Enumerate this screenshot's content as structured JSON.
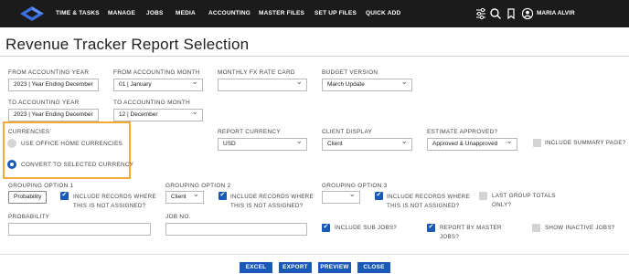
{
  "nav": {
    "items": [
      "TIME & TASKS",
      "MANAGE",
      "JOBS",
      "MEDIA",
      "ACCOUNTING",
      "MASTER FILES",
      "SET UP FILES",
      "QUICK ADD"
    ],
    "user": "MARIA ALVIR",
    "icons": [
      "sliders-icon",
      "search-icon",
      "bookmark-icon",
      "user-circle-icon"
    ],
    "colors": {
      "bar": "#1b1b1b",
      "logo": "#3b6fe0",
      "accent": "#1a59b8",
      "highlight": "#f0a93a"
    }
  },
  "page": {
    "title": "Revenue Tracker Report Selection"
  },
  "form": {
    "from_year": {
      "label": "FROM ACCOUNTING YEAR",
      "value": "2023 | Year Ending December"
    },
    "from_month": {
      "label": "FROM ACCOUNTING MONTH",
      "value": "01 | January"
    },
    "fx_rate_card": {
      "label": "MONTHLY FX RATE CARD",
      "value": ""
    },
    "budget_version": {
      "label": "BUDGET VERSION",
      "value": "March Update"
    },
    "to_year": {
      "label": "TO ACCOUNTING YEAR",
      "value": "2023 | Year Ending December"
    },
    "to_month": {
      "label": "TO ACCOUNTING MONTH",
      "value": "12 | December"
    },
    "currencies": {
      "label": "CURRENCIES",
      "option1": "USE OFFICE HOME CURRENCIES",
      "option2": "CONVERT TO SELECTED CURRENCY",
      "selected": "CONVERT TO SELECTED CURRENCY"
    },
    "report_currency": {
      "label": "REPORT CURRENCY",
      "value": "USD"
    },
    "client_display": {
      "label": "CLIENT DISPLAY",
      "value": "Client"
    },
    "estimate_approved": {
      "label": "ESTIMATE APPROVED?",
      "value": "Approved & Unapproved"
    },
    "include_summary": {
      "label": "INCLUDE SUMMARY PAGE?",
      "checked": false
    },
    "grouping1": {
      "label": "GROUPING OPTION 1",
      "value": "Probability",
      "include_label": "INCLUDE RECORDS WHERE THIS IS NOT ASSIGNED?",
      "checked": true
    },
    "grouping2": {
      "label": "GROUPING OPTION 2",
      "value": "Client",
      "include_label": "INCLUDE RECORDS WHERE THIS IS NOT ASSIGNED?",
      "checked": true
    },
    "grouping3": {
      "label": "GROUPING OPTION 3",
      "value": "",
      "include_label": "INCLUDE RECORDS WHERE THIS IS NOT ASSIGNED?",
      "checked": true
    },
    "last_group_totals": {
      "label": "LAST GROUP TOTALS ONLY?",
      "checked": false
    },
    "probability": {
      "label": "PROBABILITY",
      "value": ""
    },
    "job_no": {
      "label": "JOB NO.",
      "value": ""
    },
    "include_sub_jobs": {
      "label": "INCLUDE SUB JOBS?",
      "checked": true
    },
    "report_by_master": {
      "label": "REPORT BY MASTER JOBS?",
      "checked": true
    },
    "show_inactive": {
      "label": "SHOW INACTIVE JOBS?",
      "checked": false
    }
  },
  "buttons": {
    "excel": "EXCEL",
    "export": "EXPORT",
    "preview": "PREVIEW",
    "close": "CLOSE"
  }
}
